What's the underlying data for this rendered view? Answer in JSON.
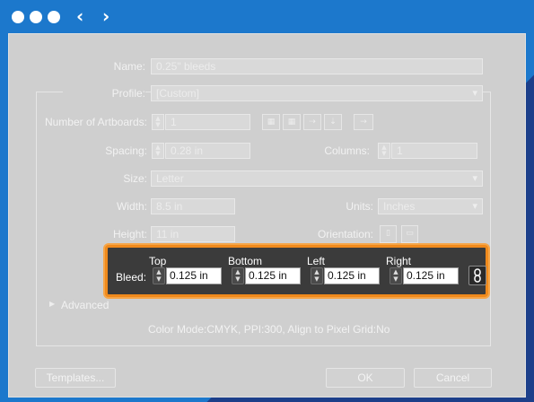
{
  "window": {
    "nav_back_glyph": "‹",
    "nav_forward_glyph": "›"
  },
  "dialog": {
    "name_label": "Name:",
    "name_value": "0.25\" bleeds",
    "profile_label": "Profile:",
    "profile_value": "[Custom]",
    "num_artboards_label": "Number of Artboards:",
    "num_artboards_value": "1",
    "spacing_label": "Spacing:",
    "spacing_value": "0.28 in",
    "columns_label": "Columns:",
    "columns_value": "1",
    "size_label": "Size:",
    "size_value": "Letter",
    "width_label": "Width:",
    "width_value": "8.5 in",
    "units_label": "Units:",
    "units_value": "Inches",
    "height_label": "Height:",
    "height_value": "11 in",
    "orientation_label": "Orientation:",
    "bleed": {
      "label": "Bleed:",
      "top_label": "Top",
      "top_value": "0.125 in",
      "bottom_label": "Bottom",
      "bottom_value": "0.125 in",
      "left_label": "Left",
      "left_value": "0.125 in",
      "right_label": "Right",
      "right_value": "0.125 in",
      "link_icon": "chain-link-icon"
    },
    "advanced_label": "Advanced",
    "summary": "Color Mode:CMYK, PPI:300, Align to Pixel Grid:No",
    "templates_button": "Templates...",
    "ok_button": "OK",
    "cancel_button": "Cancel"
  },
  "colors": {
    "titlebar": "#1c78cc",
    "highlight": "#f08a1c"
  }
}
